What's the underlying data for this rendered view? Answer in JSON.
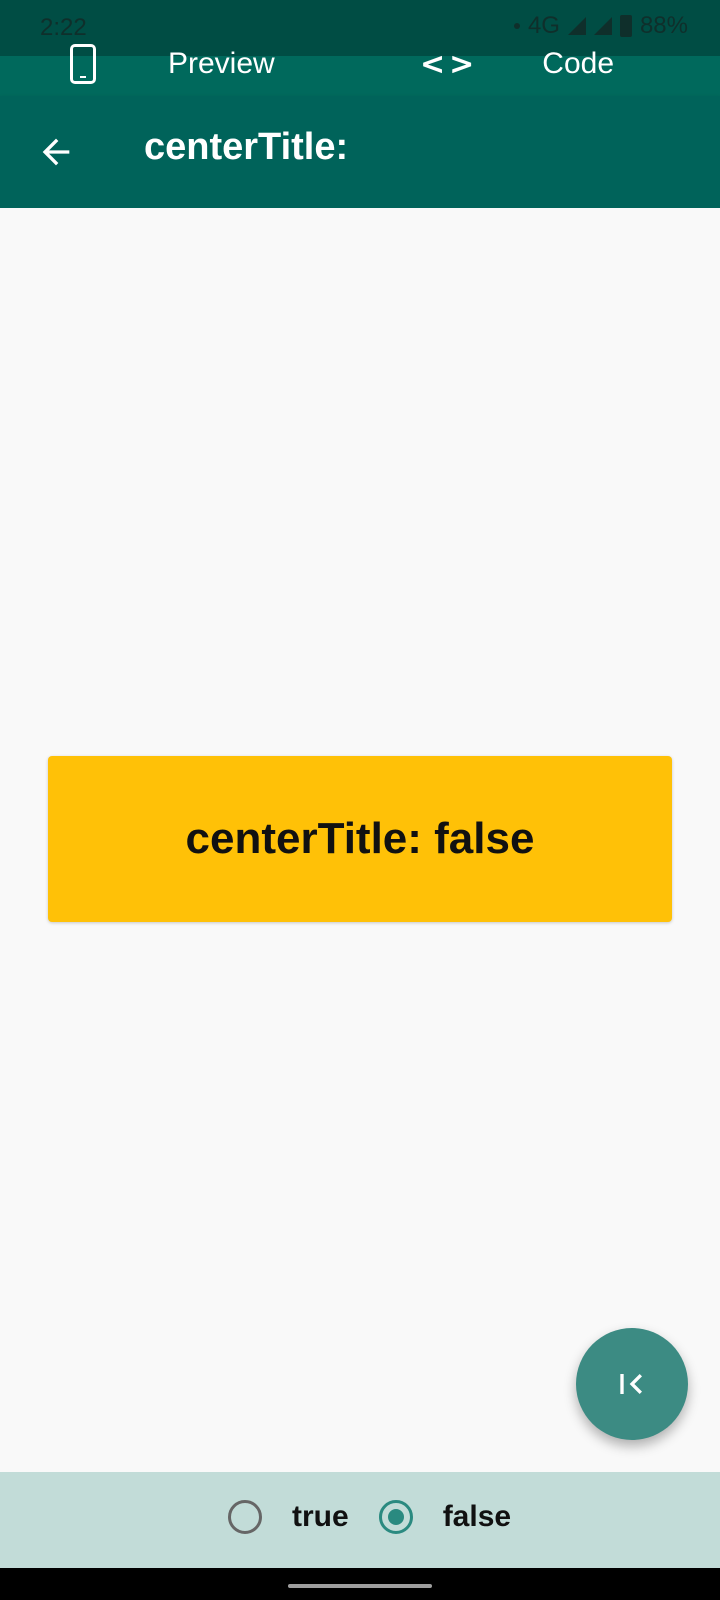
{
  "status_bar": {
    "time": "2:22",
    "network": "4G",
    "battery": "88%"
  },
  "top_tabs": {
    "preview_label": "Preview",
    "code_label": "Code"
  },
  "app_bar": {
    "title": "centerTitle:"
  },
  "content": {
    "box_text": "centerTitle: false",
    "box_color": "#ffc107"
  },
  "options": {
    "true_label": "true",
    "false_label": "false",
    "selected": "false"
  },
  "colors": {
    "primary": "#00635a",
    "accent": "#3c8b83",
    "bottom_bar": "#c2dcd8"
  },
  "icons": {
    "back": "arrow-left",
    "preview": "phone",
    "code": "code-brackets",
    "fab": "skip-to-start"
  }
}
